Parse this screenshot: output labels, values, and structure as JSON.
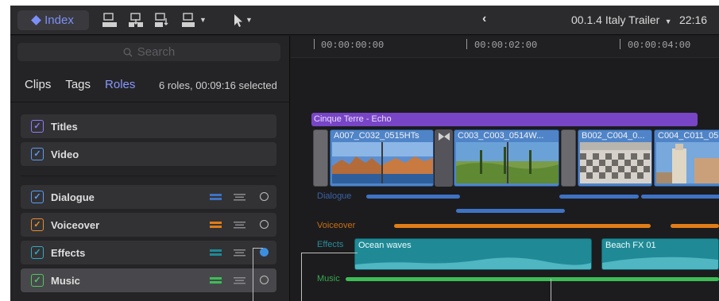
{
  "toolbar": {
    "index_label": "Index",
    "project_name": "00.1.4 Italy Trailer",
    "duration": "22:16"
  },
  "browser": {
    "search_placeholder": "Search",
    "tabs": [
      "Clips",
      "Tags",
      "Roles"
    ],
    "active_tab": "Roles",
    "roles_summary": "6 roles, 00:09:16 selected",
    "roles": [
      {
        "label": "Titles",
        "color": "#8f7cf5",
        "checked": true
      },
      {
        "label": "Video",
        "color": "#5b9bf2",
        "checked": true
      },
      {
        "label": "Dialogue",
        "color": "#5b9bf2",
        "checked": true
      },
      {
        "label": "Voiceover",
        "color": "#e58f2a",
        "checked": true
      },
      {
        "label": "Effects",
        "color": "#35a9be",
        "checked": true
      },
      {
        "label": "Music",
        "color": "#4fc860",
        "checked": true
      }
    ]
  },
  "timeline": {
    "ruler": [
      "00:00:00:00",
      "00:00:02:00",
      "00:00:04:00"
    ],
    "title_clip": "Cinque Terre - Echo",
    "video_clips": [
      "A007_C032_0515HTs",
      "C003_C003_0514W...",
      "B002_C004_0...",
      "C004_C011_05..."
    ],
    "lane_labels": {
      "dialogue": "Dialogue",
      "voiceover": "Voiceover",
      "effects": "Effects",
      "music": "Music"
    },
    "audio_clips": [
      "Ocean waves",
      "Beach FX 01"
    ]
  },
  "colors": {
    "accent": "#7c8ff8",
    "titles": "#7845c6",
    "video": "#4f84c8",
    "dialogue": "#3f72c4",
    "voiceover": "#e07d18",
    "effects": "#1f8a96",
    "music": "#3cbd55",
    "active_radio": "#3d8fde"
  }
}
